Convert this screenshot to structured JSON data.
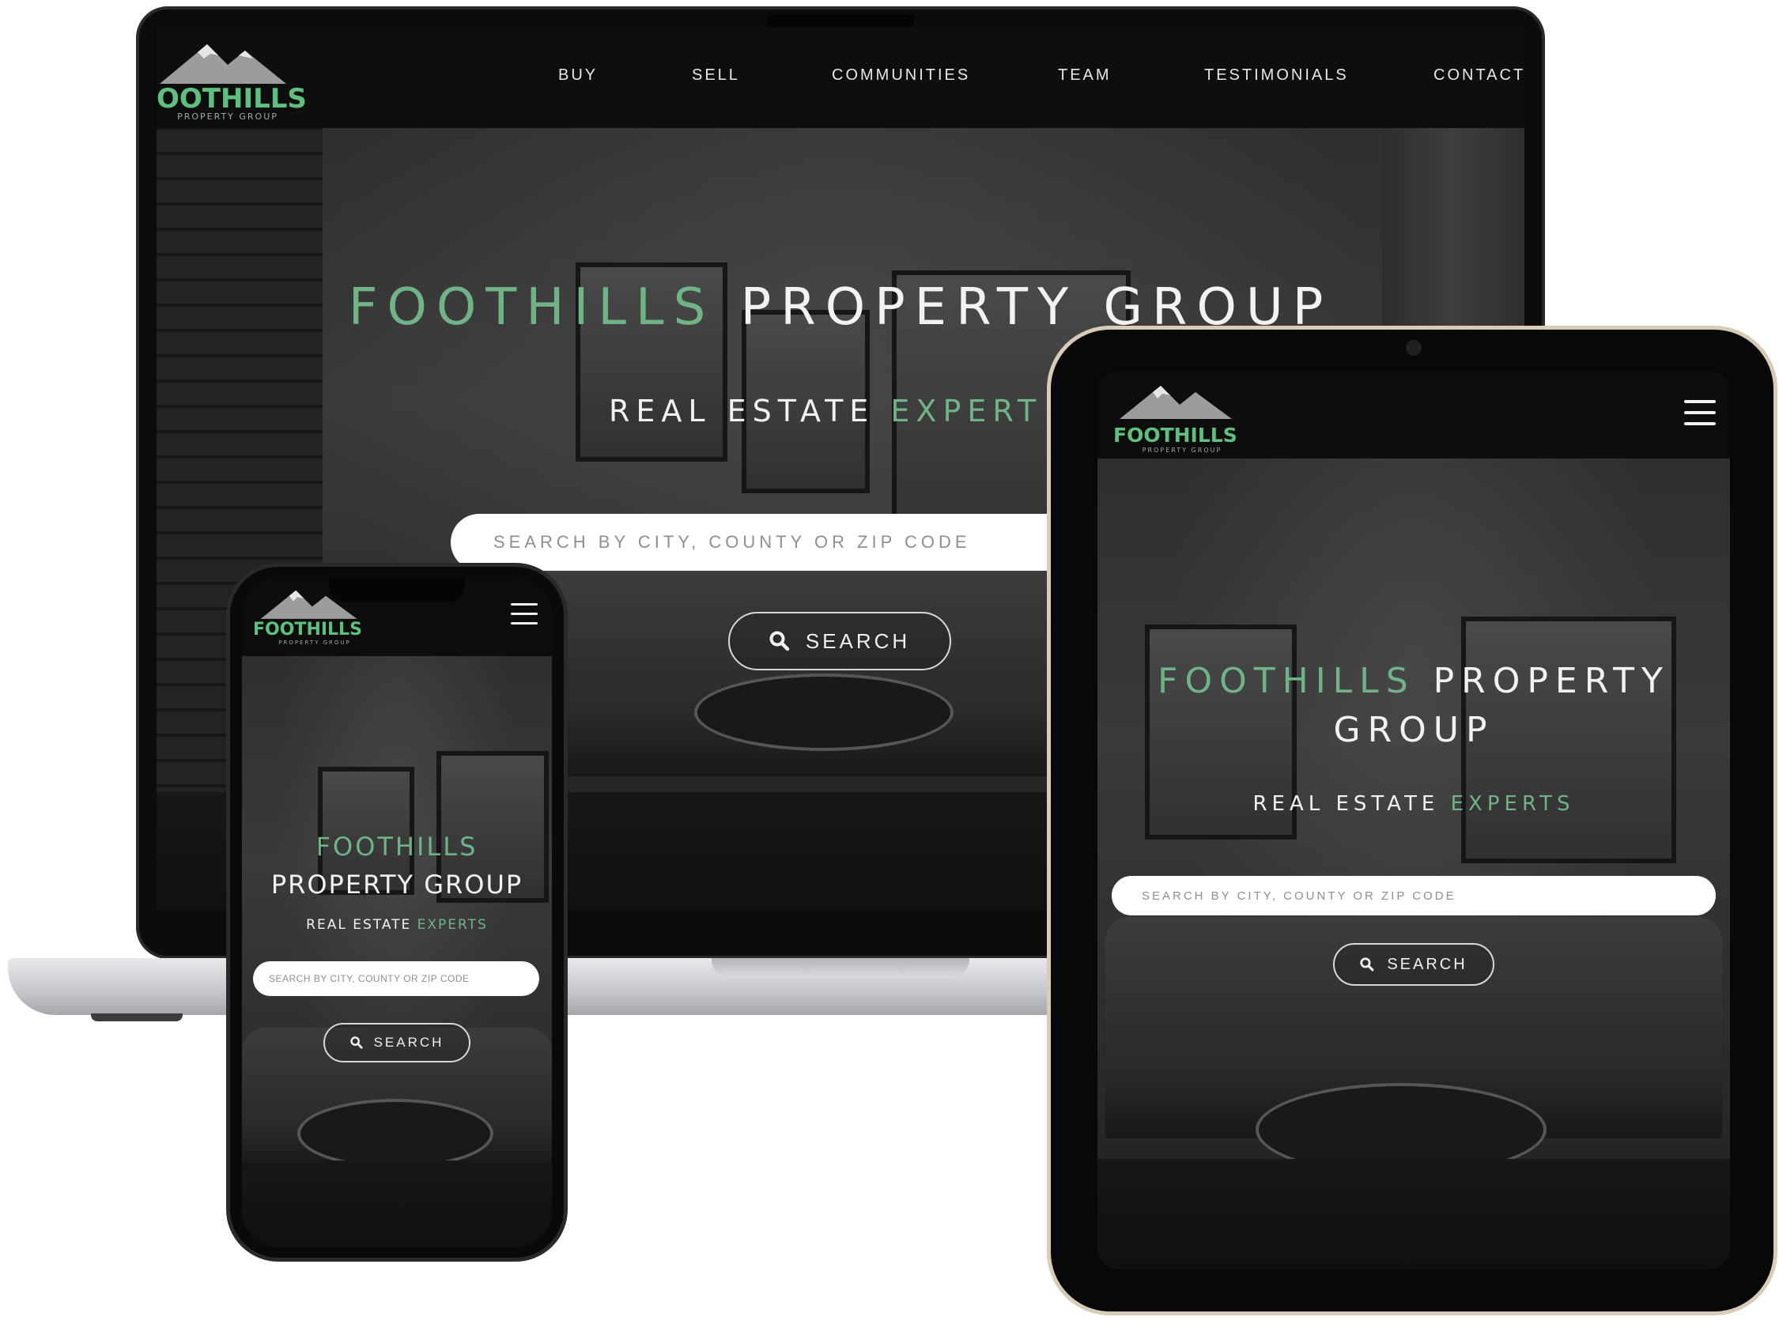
{
  "brand": {
    "logo_word": "FOOTHILLS",
    "logo_word_cropped": "OOTHILLS",
    "logo_sub": "PROPERTY GROUP",
    "colors": {
      "green": "#6fb386",
      "dark": "#0d0d0d",
      "white": "#f2f2f2"
    }
  },
  "nav": {
    "items": [
      {
        "label": "BUY"
      },
      {
        "label": "SELL"
      },
      {
        "label": "COMMUNITIES"
      },
      {
        "label": "TEAM"
      },
      {
        "label": "TESTIMONIALS"
      },
      {
        "label": "CONTACT"
      }
    ]
  },
  "hero": {
    "title_part1": "FOOTHILLS",
    "title_part2": "PROPERTY GROUP",
    "title_part2a": "PROPERTY",
    "title_part2b": "GROUP",
    "subtitle_part1": "REAL ESTATE",
    "subtitle_part2": "EXPERTS",
    "subtitle_part2_cropped": "EXPERT",
    "search_placeholder": "SEARCH BY CITY, COUNTY OR ZIP CODE",
    "search_button": "SEARCH"
  },
  "icons": {
    "search": "search-icon",
    "menu": "hamburger-menu-icon",
    "logo": "mountain-logo-icon"
  }
}
